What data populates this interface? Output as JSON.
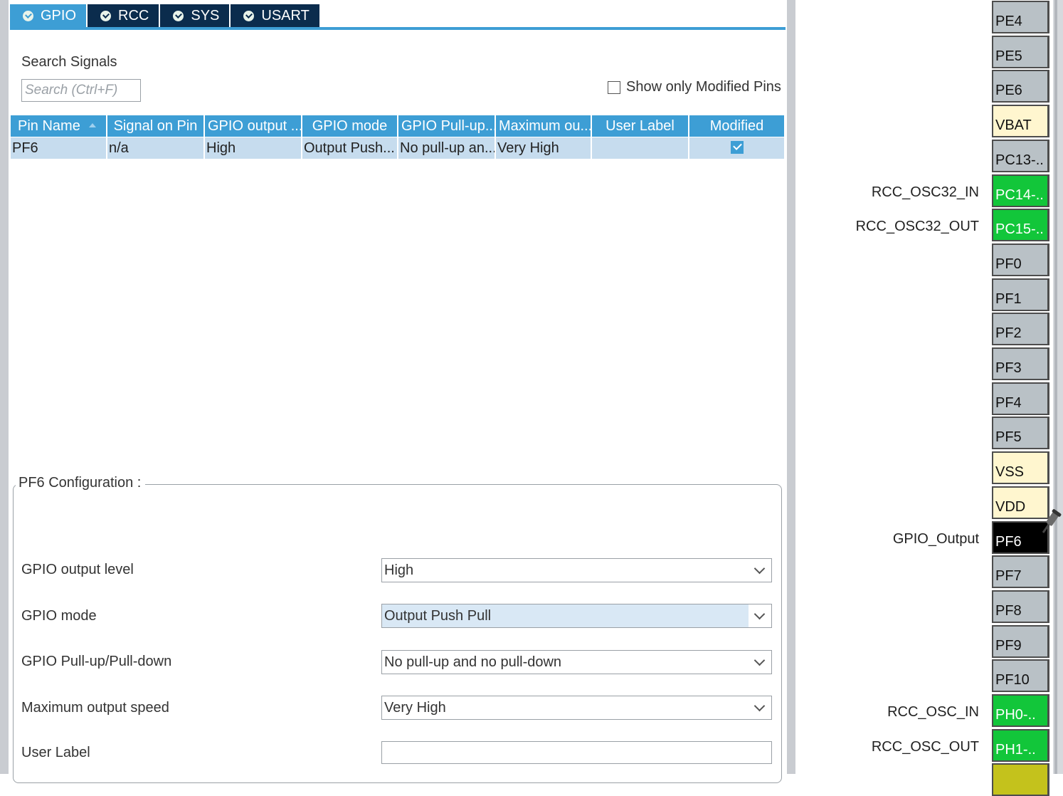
{
  "tabs": [
    {
      "label": "GPIO",
      "active": true
    },
    {
      "label": "RCC",
      "active": false
    },
    {
      "label": "SYS",
      "active": false
    },
    {
      "label": "USART",
      "active": false
    }
  ],
  "search": {
    "label": "Search Signals",
    "placeholder": "Search (Ctrl+F)",
    "show_modified_label": "Show only Modified Pins",
    "show_modified_checked": false
  },
  "table": {
    "headers": [
      "Pin Name",
      "Signal on Pin",
      "GPIO output ...",
      "GPIO mode",
      "GPIO Pull-up...",
      "Maximum ou...",
      "User Label",
      "Modified"
    ],
    "rows": [
      {
        "pin": "PF6",
        "signal": "n/a",
        "output": "High",
        "mode": "Output Push...",
        "pull": "No pull-up an...",
        "speed": "Very High",
        "user_label": "",
        "modified": true
      }
    ]
  },
  "config": {
    "title": "PF6 Configuration :",
    "fields": [
      {
        "label": "GPIO output level",
        "value": "High"
      },
      {
        "label": "GPIO mode",
        "value": "Output Push Pull"
      },
      {
        "label": "GPIO Pull-up/Pull-down",
        "value": "No pull-up and no pull-down"
      },
      {
        "label": "Maximum output speed",
        "value": "Very High"
      },
      {
        "label": "User Label",
        "value": ""
      }
    ]
  },
  "pins": [
    {
      "name": "PE4",
      "color": "gray",
      "signal": ""
    },
    {
      "name": "PE5",
      "color": "gray",
      "signal": ""
    },
    {
      "name": "PE6",
      "color": "gray",
      "signal": ""
    },
    {
      "name": "VBAT",
      "color": "yellow",
      "signal": ""
    },
    {
      "name": "PC13-..",
      "color": "gray",
      "signal": ""
    },
    {
      "name": "PC14-..",
      "color": "green",
      "signal": "RCC_OSC32_IN"
    },
    {
      "name": "PC15-..",
      "color": "green",
      "signal": "RCC_OSC32_OUT"
    },
    {
      "name": "PF0",
      "color": "gray",
      "signal": ""
    },
    {
      "name": "PF1",
      "color": "gray",
      "signal": ""
    },
    {
      "name": "PF2",
      "color": "gray",
      "signal": ""
    },
    {
      "name": "PF3",
      "color": "gray",
      "signal": ""
    },
    {
      "name": "PF4",
      "color": "gray",
      "signal": ""
    },
    {
      "name": "PF5",
      "color": "gray",
      "signal": ""
    },
    {
      "name": "VSS",
      "color": "yellow",
      "signal": ""
    },
    {
      "name": "VDD",
      "color": "yellow",
      "signal": ""
    },
    {
      "name": "PF6",
      "color": "black",
      "signal": "GPIO_Output"
    },
    {
      "name": "PF7",
      "color": "gray",
      "signal": ""
    },
    {
      "name": "PF8",
      "color": "gray",
      "signal": ""
    },
    {
      "name": "PF9",
      "color": "gray",
      "signal": ""
    },
    {
      "name": "PF10",
      "color": "gray",
      "signal": ""
    },
    {
      "name": "PH0-..",
      "color": "green",
      "signal": "RCC_OSC_IN"
    },
    {
      "name": "PH1-..",
      "color": "green",
      "signal": "RCC_OSC_OUT"
    },
    {
      "name": "",
      "color": "olive",
      "signal": ""
    }
  ],
  "colors": {
    "tab_active": "#3d9ed5",
    "tab_inactive": "#0b2c4d",
    "row_selected": "#c6dcee",
    "pin_gray": "#b9c1c6",
    "pin_power": "#fff6cf",
    "pin_assigned": "#12c63a",
    "pin_selected": "#000000"
  },
  "icons": [
    "check-circle-icon",
    "sort-icon",
    "checkbox-icon",
    "chevron-down-icon",
    "pushpin-icon"
  ]
}
